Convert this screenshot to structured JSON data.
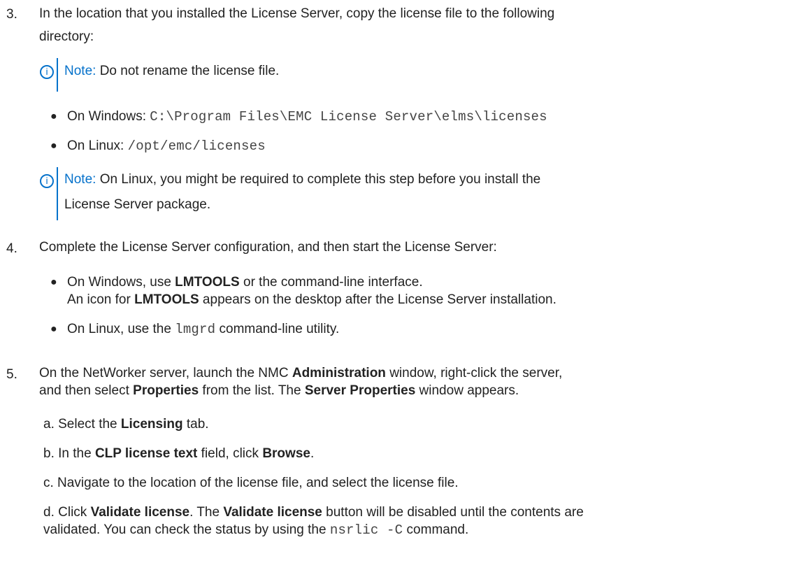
{
  "accent_color": "#0672cb",
  "icons": {
    "note": "info-circle-icon"
  },
  "step3": {
    "number": "3.",
    "line1": "In the location that you installed the License Server, copy the license file to the following",
    "line2": "directory:",
    "note1": {
      "label": "Note:",
      "text": " Do not rename the license file."
    },
    "windows": {
      "label": "On Windows: ",
      "path": "C:\\Program Files\\EMC License Server\\elms\\licenses"
    },
    "linux": {
      "label": "On Linux: ",
      "path": "/opt/emc/licenses"
    },
    "note2": {
      "label": "Note:",
      "text1": " On Linux, you might be required to complete this step before you install the",
      "text2": "License Server package."
    }
  },
  "step4": {
    "number": "4.",
    "line1": "Complete the License Server configuration, and then start the License Server:",
    "bullet1": {
      "a": "On Windows, use ",
      "b": "LMTOOLS",
      "c": " or the command-line interface.",
      "d": "An icon for ",
      "e": "LMTOOLS",
      "f": " appears on the desktop after the License Server installation."
    },
    "bullet2": {
      "a": "On Linux, use the ",
      "code": "lmgrd",
      "b": " command-line utility."
    }
  },
  "step5": {
    "number": "5.",
    "line1": {
      "a": "On the NetWorker server, launch the NMC ",
      "b": "Administration",
      "c": " window, right-click the server,"
    },
    "line2": {
      "a": "and then select ",
      "b": "Properties",
      "c": " from the list. The ",
      "d": "Server Properties",
      "e": " window appears."
    },
    "a": {
      "a": "a. Select the ",
      "b": "Licensing",
      "c": " tab."
    },
    "b": {
      "a": "b. In the ",
      "b": "CLP license text",
      "c": " field, click ",
      "d": "Browse",
      "e": "."
    },
    "c": {
      "a": "c. Navigate to the location of the license file, and select the license file."
    },
    "d": {
      "a": "d. Click ",
      "b": "Validate license",
      "c": ". The ",
      "d": "Validate license",
      "e": " button will be disabled until the contents are",
      "f": "validated. You can check the status by using the ",
      "code": "nsrlic -C",
      "g": " command."
    }
  }
}
